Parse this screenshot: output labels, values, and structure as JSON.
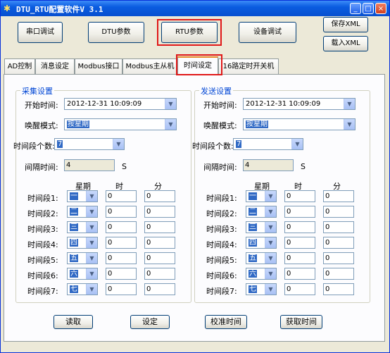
{
  "window": {
    "title": "DTU_RTU配置软件V 3.1",
    "min": "_",
    "max": "□",
    "close": "×"
  },
  "top_buttons": {
    "serial": "串口调试",
    "dtu": "DTU参数",
    "rtu": "RTU参数",
    "device": "设备调试",
    "save_xml": "保存XML",
    "load_xml": "载入XML"
  },
  "tabs": [
    "AD控制",
    "消息设定",
    "Modbus接口",
    "Modbus主从机",
    "时间设定",
    "16路定时开关机"
  ],
  "active_tab": "时间设定",
  "groups": [
    {
      "title": "采集设置",
      "start_label": "开始时间:",
      "start_value": "2012-12-31 10:09:09",
      "wake_label": "唤醒模式:",
      "wake_value": "按星期",
      "count_label": "时间段个数:",
      "count_value": "7",
      "interval_label": "间隔时间:",
      "interval_value": "4",
      "interval_unit": "S",
      "col_week": "星期",
      "col_hour": "时",
      "col_min": "分",
      "rows": [
        {
          "label": "时间段1:",
          "day": "一",
          "hour": "0",
          "min": "0"
        },
        {
          "label": "时间段2:",
          "day": "二",
          "hour": "0",
          "min": "0"
        },
        {
          "label": "时间段3:",
          "day": "三",
          "hour": "0",
          "min": "0"
        },
        {
          "label": "时间段4:",
          "day": "四",
          "hour": "0",
          "min": "0"
        },
        {
          "label": "时间段5:",
          "day": "五",
          "hour": "0",
          "min": "0"
        },
        {
          "label": "时间段6:",
          "day": "六",
          "hour": "0",
          "min": "0"
        },
        {
          "label": "时间段7:",
          "day": "七",
          "hour": "0",
          "min": "0"
        }
      ]
    },
    {
      "title": "发送设置",
      "start_label": "开始时间:",
      "start_value": "2012-12-31 10:09:09",
      "wake_label": "唤醒模式:",
      "wake_value": "按星期",
      "count_label": "时间段个数:",
      "count_value": "7",
      "interval_label": "间隔时间:",
      "interval_value": "4",
      "interval_unit": "S",
      "col_week": "星期",
      "col_hour": "时",
      "col_min": "分",
      "rows": [
        {
          "label": "时间段1:",
          "day": "一",
          "hour": "0",
          "min": "0"
        },
        {
          "label": "时间段2:",
          "day": "二",
          "hour": "0",
          "min": "0"
        },
        {
          "label": "时间段3:",
          "day": "三",
          "hour": "0",
          "min": "0"
        },
        {
          "label": "时间段4:",
          "day": "四",
          "hour": "0",
          "min": "0"
        },
        {
          "label": "时间段5:",
          "day": "五",
          "hour": "0",
          "min": "0"
        },
        {
          "label": "时间段6:",
          "day": "六",
          "hour": "0",
          "min": "0"
        },
        {
          "label": "时间段7:",
          "day": "七",
          "hour": "0",
          "min": "0"
        }
      ]
    }
  ],
  "bottom_buttons": {
    "read": "读取",
    "set": "设定",
    "sync": "校准时间",
    "get": "获取时间"
  },
  "icons": {
    "app": "app-gear-icon",
    "dropdown": "chevron-down-icon"
  },
  "colors": {
    "titlebar": "#0a5ce0",
    "highlight_box": "#e01818",
    "group_title": "#0046d5",
    "selection": "#316ac5"
  }
}
